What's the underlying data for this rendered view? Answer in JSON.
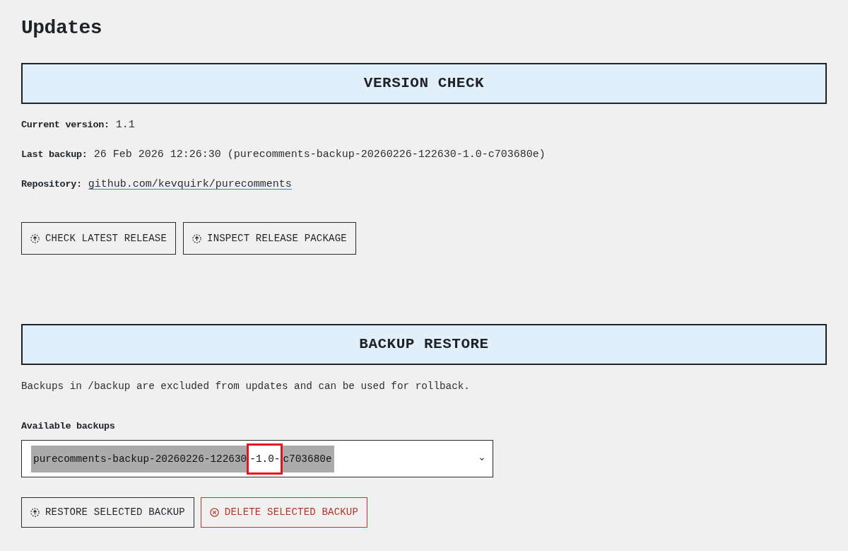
{
  "page_title": "Updates",
  "sections": [
    {
      "kind": "version",
      "heading": "VERSION CHECK",
      "fields": [
        {
          "kind": "text",
          "label": "Current version:",
          "value": "1.1"
        },
        {
          "kind": "text",
          "label": "Last backup:",
          "value": "26 Feb 2026 12:26:30 (purecomments-backup-20260226-122630-1.0-c703680e)"
        },
        {
          "kind": "link",
          "label": "Repository:",
          "value": "github.com/kevquirk/purecomments"
        }
      ],
      "buttons": [
        {
          "kind": "upload",
          "label": "CHECK LATEST RELEASE"
        },
        {
          "kind": "upload",
          "label": "INSPECT RELEASE PACKAGE"
        }
      ]
    },
    {
      "kind": "restore",
      "heading": "BACKUP RESTORE",
      "description": "Backups in /backup are excluded from updates and can be used for rollback.",
      "select": {
        "label": "Available backups",
        "segments": [
          {
            "text": "purecomments-backup-20260226-122630",
            "marked": false
          },
          {
            "text": "-1.0-",
            "marked": true
          },
          {
            "text": "c703680e",
            "marked": false
          }
        ]
      },
      "buttons": [
        {
          "kind": "upload",
          "label": "RESTORE SELECTED BACKUP"
        },
        {
          "kind": "delete",
          "label": "DELETE SELECTED BACKUP"
        }
      ]
    }
  ]
}
